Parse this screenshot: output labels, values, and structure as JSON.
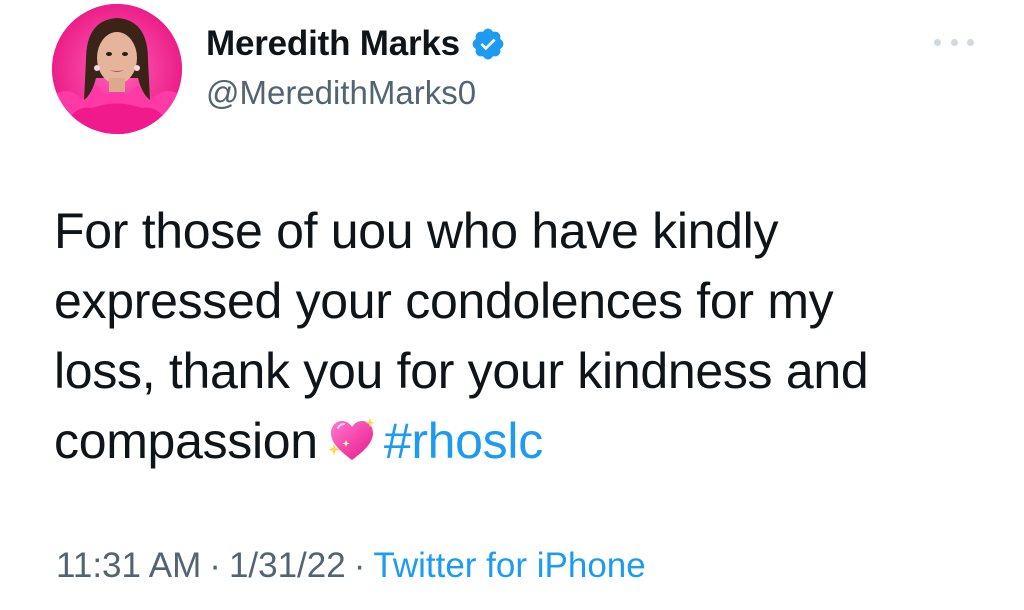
{
  "tweet": {
    "author": {
      "display_name": "Meredith Marks",
      "handle": "@MeredithMarks0",
      "verified": true,
      "avatar_icon": "avatar-photo",
      "verified_icon": "verified-badge-icon"
    },
    "more_icon": "more-options-icon",
    "text_lines": [
      "For those of uou who have kindly",
      "expressed your condolences for my",
      "loss, thank you for your kindness and",
      "compassion"
    ],
    "emoji": "sparkling-heart-icon",
    "hashtag": "#rhoslc",
    "meta": {
      "time": "11:31 AM",
      "date": "1/31/22",
      "separator": "·",
      "source": "Twitter for iPhone"
    }
  },
  "colors": {
    "text_primary": "#0f1419",
    "text_secondary": "#536471",
    "link_blue": "#1d9bf0",
    "verified_blue": "#1d9bf0",
    "avatar_pink": "#ff2fa0"
  }
}
